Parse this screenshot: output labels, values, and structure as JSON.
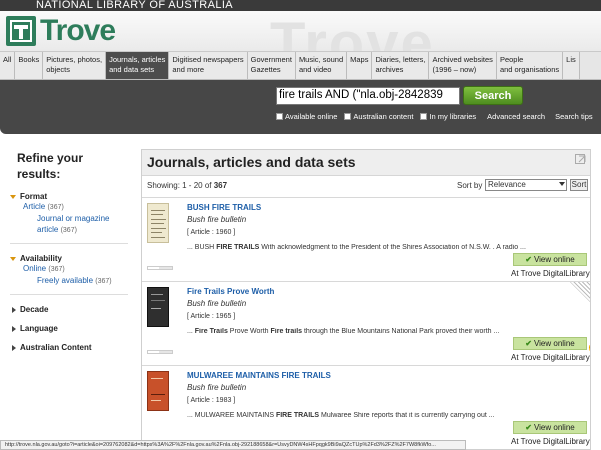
{
  "header": {
    "org": "NATIONAL LIBRARY OF AUSTRALIA",
    "logo_text": "Trove",
    "watermark": "Trove"
  },
  "tabs": [
    {
      "label": "All",
      "sub": ""
    },
    {
      "label": "Books",
      "sub": ""
    },
    {
      "label": "Pictures, photos,",
      "sub": "objects"
    },
    {
      "label": "Journals, articles",
      "sub": "and data sets",
      "active": true
    },
    {
      "label": "Digitised newspapers",
      "sub": "and more"
    },
    {
      "label": "Government",
      "sub": "Gazettes"
    },
    {
      "label": "Music, sound",
      "sub": "and video"
    },
    {
      "label": "Maps",
      "sub": ""
    },
    {
      "label": "Diaries, letters,",
      "sub": "archives"
    },
    {
      "label": "Archived websites",
      "sub": "(1996 – now)"
    },
    {
      "label": "People",
      "sub": "and organisations"
    },
    {
      "label": "Lis",
      "sub": ""
    }
  ],
  "search": {
    "query": "fire trails  AND (\"nla.obj-2842839",
    "button_label": "Search",
    "opt_online": "Available online",
    "opt_australian": "Australian content",
    "opt_libraries": "In my libraries",
    "advanced": "Advanced search",
    "tips": "Search tips"
  },
  "refine": {
    "title": "Refine your results:",
    "format_head": "Format",
    "format_article": "Article",
    "format_article_count": "(367)",
    "format_journal": "Journal or magazine",
    "format_journal2": "article",
    "format_journal_count": "(367)",
    "availability_head": "Availability",
    "avail_online": "Online",
    "avail_online_count": "(367)",
    "avail_free": "Freely available",
    "avail_free_count": "(367)",
    "decade": "Decade",
    "language": "Language",
    "australian": "Australian Content"
  },
  "results": {
    "title": "Journals, articles and data sets",
    "showing_prefix": "Showing: 1 - 20 of ",
    "total": "367",
    "sort_label": "Sort by",
    "sort_value": "Relevance",
    "sort_button": "Sort",
    "items": [
      {
        "title": "BUSH FIRE TRAILS",
        "source": "Bush fire bulletin",
        "type": "[ Article : 1960 ]",
        "snippet_pre": "... BUSH ",
        "snippet_b1": "FIRE TRAILS",
        "snippet_post": " With acknowledgment to the President of the Shires Association of N.S.W. . A radio ...",
        "button": "View online",
        "library": "At Trove DigitalLibrary"
      },
      {
        "title": "Fire Trails Prove Worth",
        "source": "Bush fire bulletin",
        "type": "[ Article : 1965 ]",
        "snippet_pre": "... ",
        "snippet_b1": "Fire Trails",
        "snippet_mid": " Prove Worth ",
        "snippet_b2": "Fire trails",
        "snippet_post": " through the Blue Mountains National Park proved their worth ...",
        "button": "View online",
        "library": "At Trove DigitalLibrary"
      },
      {
        "title": "MULWAREE MAINTAINS FIRE TRAILS",
        "source": "Bush fire bulletin",
        "type": "[ Article : 1983 ]",
        "snippet_pre": "... MULWAREE MAINTAINS ",
        "snippet_b1": "FIRE TRAILS",
        "snippet_post": " Mulwaree Shire reports that it is currently carrying out ...",
        "button": "View online",
        "library": "At Trove DigitalLibrary"
      }
    ]
  },
  "status": {
    "url": "http://trove.nla.gov.au/goto?i=article&oi=209762082&d=https%3A%2F%2Fnla.gov.au%2Fnla.obj-292188658&r=UsvyDNW4sHFpqgk9Bi9aQZcTUp%2Fd3%2FZ%2F7W8fkWfo..."
  },
  "colors": {
    "brand_green": "#2e7d5b",
    "search_button": "#5fa32a",
    "link_blue": "#1d5ea8",
    "view_online_bg": "#c9e39f",
    "facet_arrow": "#d9950e"
  },
  "icons": [
    "check-icon",
    "expand-icon",
    "mouse-cursor-icon"
  ]
}
